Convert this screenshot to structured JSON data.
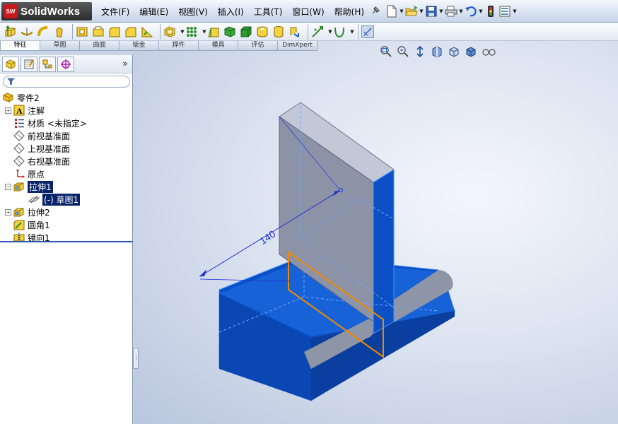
{
  "app": {
    "title": "SolidWorks",
    "badge": "SW"
  },
  "menu": [
    "文件(F)",
    "编辑(E)",
    "视图(V)",
    "插入(I)",
    "工具(T)",
    "窗口(W)",
    "帮助(H)"
  ],
  "command_tabs": [
    "特征",
    "草图",
    "曲面",
    "钣金",
    "焊件",
    "模具",
    "评估",
    "DimXpert"
  ],
  "active_tab": "特征",
  "feature_tree": {
    "filter_placeholder": "",
    "root": "零件2",
    "nodes": [
      {
        "label": "注解",
        "icon": "annotation-icon",
        "expandable": true
      },
      {
        "label": "材质 <未指定>",
        "icon": "material-icon",
        "expandable": false
      },
      {
        "label": "前视基准面",
        "icon": "plane-icon",
        "expandable": false
      },
      {
        "label": "上视基准面",
        "icon": "plane-icon",
        "expandable": false
      },
      {
        "label": "右视基准面",
        "icon": "plane-icon",
        "expandable": false
      },
      {
        "label": "原点",
        "icon": "origin-icon",
        "expandable": false
      },
      {
        "label": "拉伸1",
        "icon": "extrude-icon",
        "expandable": true,
        "expanded": true,
        "selected": true
      },
      {
        "label": "(-) 草图1",
        "icon": "sketch-icon",
        "child": true,
        "selected": true
      },
      {
        "label": "拉伸2",
        "icon": "extrude-icon",
        "expandable": true
      },
      {
        "label": "圆角1",
        "icon": "fillet-icon",
        "expandable": false
      },
      {
        "label": "镜向1",
        "icon": "mirror-icon",
        "expandable": false
      }
    ]
  },
  "viewport": {
    "dimension_label": "140"
  },
  "colors": {
    "part_blue": "#0a55c8",
    "part_grey": "#8a92a6",
    "sketch_orange": "#f08a00",
    "selection": "#0a246a"
  }
}
